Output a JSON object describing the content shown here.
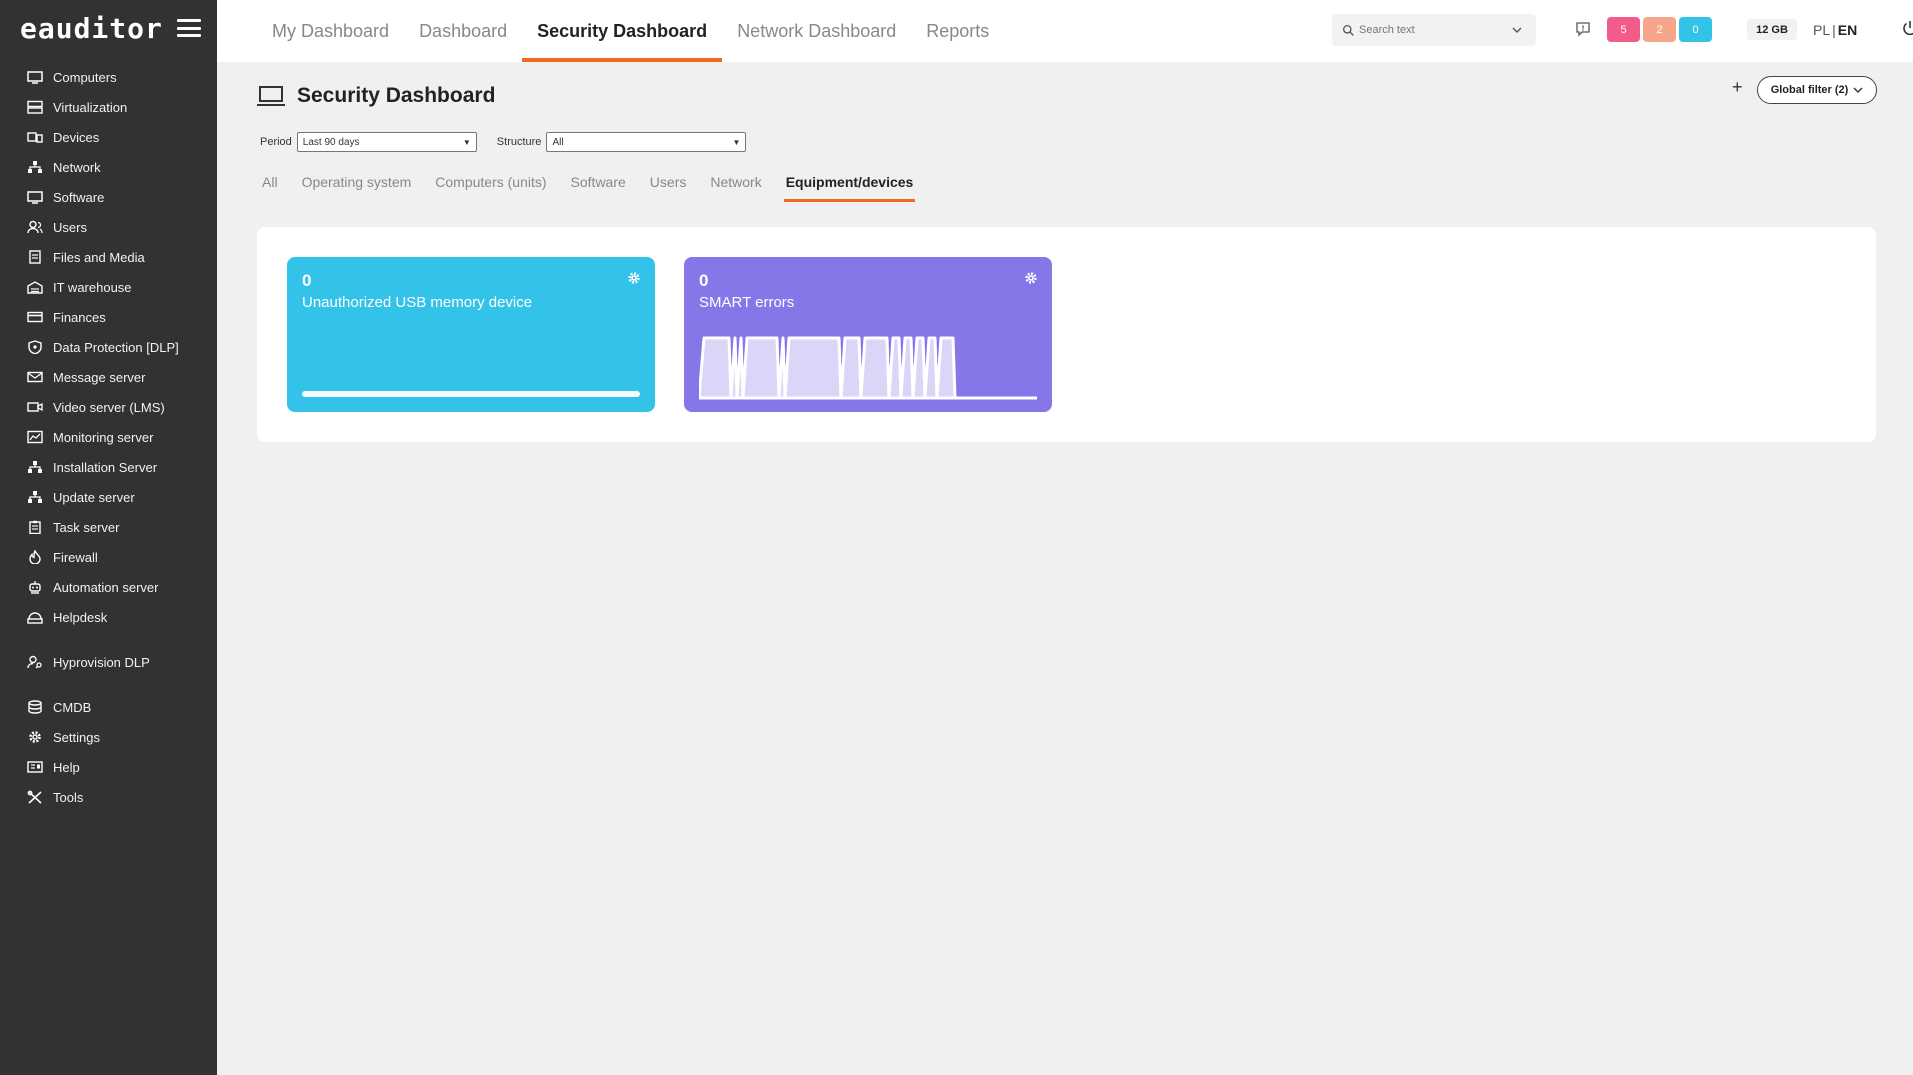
{
  "app": {
    "logo": "eauditor"
  },
  "sidebar": {
    "items": [
      {
        "label": "Computers",
        "icon": "monitor-icon"
      },
      {
        "label": "Virtualization",
        "icon": "server-icon"
      },
      {
        "label": "Devices",
        "icon": "devices-icon"
      },
      {
        "label": "Network",
        "icon": "network-icon"
      },
      {
        "label": "Software",
        "icon": "monitor-icon"
      },
      {
        "label": "Users",
        "icon": "users-icon"
      },
      {
        "label": "Files and Media",
        "icon": "file-icon"
      },
      {
        "label": "IT warehouse",
        "icon": "warehouse-icon"
      },
      {
        "label": "Finances",
        "icon": "card-icon"
      },
      {
        "label": "Data Protection [DLP]",
        "icon": "shield-icon"
      },
      {
        "label": "Message server",
        "icon": "mail-icon"
      },
      {
        "label": "Video server (LMS)",
        "icon": "video-icon"
      },
      {
        "label": "Monitoring server",
        "icon": "chart-icon"
      },
      {
        "label": "Installation Server",
        "icon": "network-icon"
      },
      {
        "label": "Update server",
        "icon": "network-icon"
      },
      {
        "label": "Task server",
        "icon": "clipboard-icon"
      },
      {
        "label": "Firewall",
        "icon": "fire-icon"
      },
      {
        "label": "Automation server",
        "icon": "robot-icon"
      },
      {
        "label": "Helpdesk",
        "icon": "helpdesk-icon"
      }
    ],
    "items2": [
      {
        "label": "Hyprovision DLP",
        "icon": "user-key-icon"
      }
    ],
    "items3": [
      {
        "label": "CMDB",
        "icon": "database-icon"
      },
      {
        "label": "Settings",
        "icon": "gear-icon"
      },
      {
        "label": "Help",
        "icon": "help-icon"
      },
      {
        "label": "Tools",
        "icon": "tools-icon"
      }
    ]
  },
  "topnav": {
    "tabs": [
      "My Dashboard",
      "Dashboard",
      "Security Dashboard",
      "Network Dashboard",
      "Reports"
    ],
    "active": "Security Dashboard",
    "search_placeholder": "Search text",
    "badges": [
      {
        "value": "5",
        "color": "#f25c8a"
      },
      {
        "value": "2",
        "color": "#f7a58a"
      },
      {
        "value": "0",
        "color": "#33c3e8"
      }
    ],
    "storage": "12 GB",
    "lang_pl": "PL",
    "lang_sep": "|",
    "lang_en": "EN"
  },
  "page": {
    "title": "Security Dashboard",
    "add_symbol": "+",
    "global_filter": "Global filter (2)",
    "period_label": "Period",
    "period_value": "Last 90 days",
    "structure_label": "Structure",
    "structure_value": "All",
    "subtabs": [
      "All",
      "Operating system",
      "Computers (units)",
      "Software",
      "Users",
      "Network",
      "Equipment/devices"
    ],
    "active_subtab": "Equipment/devices"
  },
  "widgets": [
    {
      "count": "0",
      "label": "Unauthorized USB memory device",
      "color": "#33c3e8"
    },
    {
      "count": "0",
      "label": "SMART errors",
      "color": "#8577e8"
    }
  ],
  "colors": {
    "accent": "#f06a20",
    "sidebar_bg": "#333132"
  }
}
